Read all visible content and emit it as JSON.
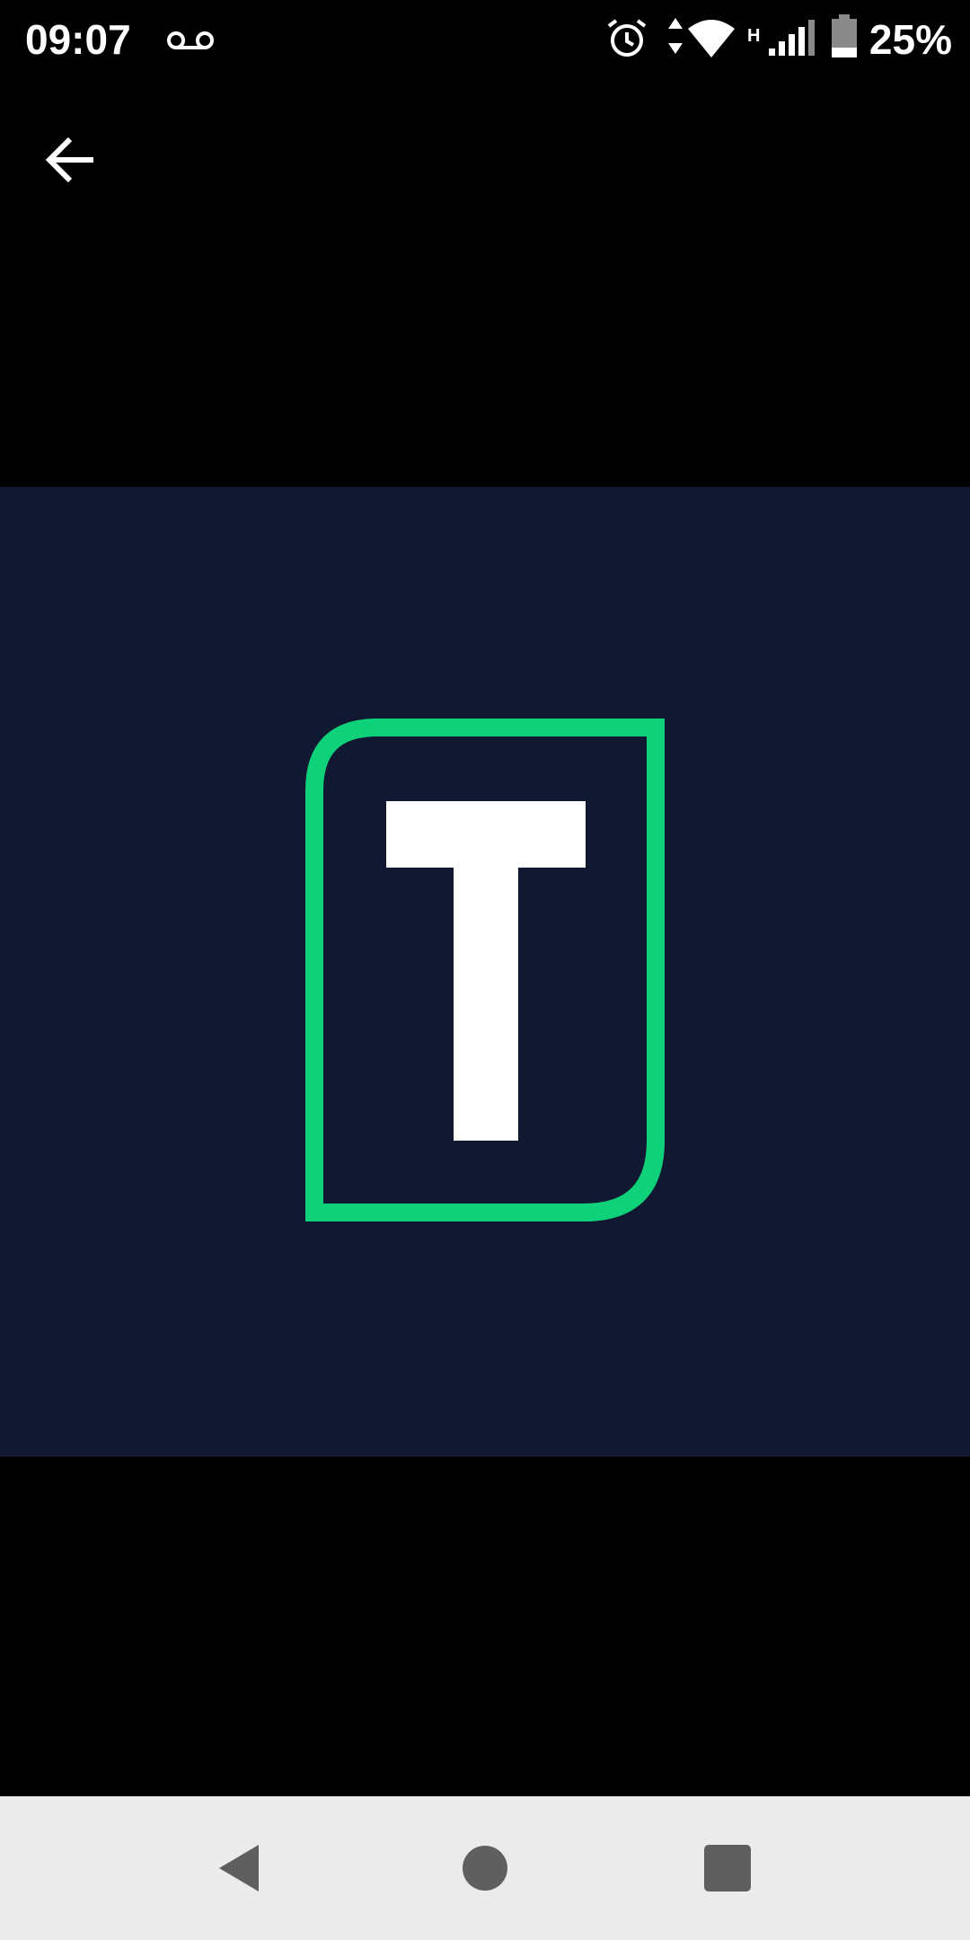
{
  "status_bar": {
    "time": "09:07",
    "battery_percent": "25%",
    "icons": [
      "voicemail-icon",
      "alarm-icon",
      "data-arrows-icon",
      "wifi-icon",
      "network-type-icon",
      "cell-signal-icon",
      "battery-icon"
    ],
    "network_type": "H",
    "battery_level": 0.25
  },
  "toolbar": {
    "back_icon": "arrow-left-icon"
  },
  "viewer": {
    "background_color": "#111831",
    "logo": {
      "letter": "T",
      "border_color": "#0fd17a",
      "letter_color": "#ffffff"
    }
  },
  "navigation": {
    "buttons": [
      "back-triangle-icon",
      "home-circle-icon",
      "recents-square-icon"
    ],
    "background_color": "#ebebeb",
    "icon_color": "#5f5f5f"
  }
}
